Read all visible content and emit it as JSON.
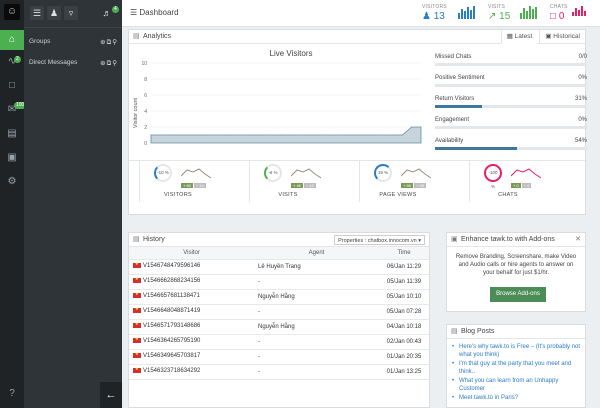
{
  "rail": {
    "online_badge": "",
    "chats_badge": "2",
    "inbox_badge": "100"
  },
  "sidebar": {
    "groups_label": "Groups",
    "dm_label": "Direct Messages",
    "notif_badge": "4"
  },
  "header": {
    "title": "Dashboard",
    "visitors_label": "VISITORS",
    "visitors_value": "13",
    "visits_label": "VISITS",
    "visits_value": "15",
    "chats_label": "CHATS",
    "chats_value": "0"
  },
  "analytics": {
    "title": "Analytics",
    "tab_latest": "Latest",
    "tab_historical": "Historical",
    "chart_title": "Live Visitors",
    "y_label": "Visitor count",
    "metrics": [
      {
        "label": "Missed Chats",
        "value": "0/0",
        "fill": 0
      },
      {
        "label": "Positive Sentiment",
        "value": "0%",
        "fill": 0
      },
      {
        "label": "Return Visitors",
        "value": "31%",
        "fill": 0.31
      },
      {
        "label": "Engagement",
        "value": "0%",
        "fill": 0
      },
      {
        "label": "Availability",
        "value": "54%",
        "fill": 0.54
      }
    ],
    "kpis": [
      {
        "label": "VISITORS",
        "ring": "-10 %",
        "a": "+ 60",
        "b": "+ 10"
      },
      {
        "label": "VISITS",
        "ring": "-6 %",
        "a": "+ 46",
        "b": "+ 10"
      },
      {
        "label": "PAGE VIEWS",
        "ring": "19 %",
        "a": "+ 56",
        "b": "+ 35"
      },
      {
        "label": "CHATS",
        "ring": "-100 %",
        "a": "+ 0",
        "b": "+ 0"
      }
    ]
  },
  "chart_data": {
    "type": "area",
    "title": "Live Visitors",
    "ylabel": "Visitor count",
    "ylim": [
      0,
      10
    ],
    "yticks": [
      0,
      2,
      4,
      6,
      8,
      10
    ],
    "values": [
      1,
      1,
      1,
      1,
      1,
      1,
      1,
      1,
      1,
      1,
      1,
      1,
      1,
      1,
      1,
      1,
      1,
      1,
      1,
      1,
      1,
      1,
      1,
      1,
      1,
      1,
      1,
      1,
      2,
      2
    ]
  },
  "history": {
    "title": "History",
    "property_select": "Properties : chatbox.innocom.vn",
    "columns": [
      "Visitor",
      "Agent",
      "Time"
    ],
    "rows": [
      [
        "V1546748479596146",
        "Lê Huyền Trang",
        "06/Jan 11:29"
      ],
      [
        "V1546662868234156",
        "-",
        "05/Jan 11:39"
      ],
      [
        "V1546657681138471",
        "Nguyễn Hằng",
        "05/Jan 10:10"
      ],
      [
        "V1546648048871419",
        "-",
        "05/Jan 07:28"
      ],
      [
        "V1546571793148686",
        "Nguyễn Hằng",
        "04/Jan 10:18"
      ],
      [
        "V1546364265795190",
        "-",
        "02/Jan 00:43"
      ],
      [
        "V1546349645703817",
        "-",
        "01/Jan 20:35"
      ],
      [
        "V1546323718634292",
        "-",
        "01/Jan 13:25"
      ]
    ]
  },
  "addons": {
    "title": "Enhance tawk.to with Add-ons",
    "body": "Remove Branding, Screenshare, make Video and Audio calls or hire agents to answer on your behalf for just $1/hr.",
    "button": "Browse Add-ons"
  },
  "blog": {
    "title": "Blog Posts",
    "posts": [
      "Here's why tawk.to is Free – (It's probably not what you think)",
      "I'm that guy at the party that you meet and think..",
      "What you can learn from an Unhappy Customer",
      "Meet tawk.to in Paris?"
    ]
  }
}
